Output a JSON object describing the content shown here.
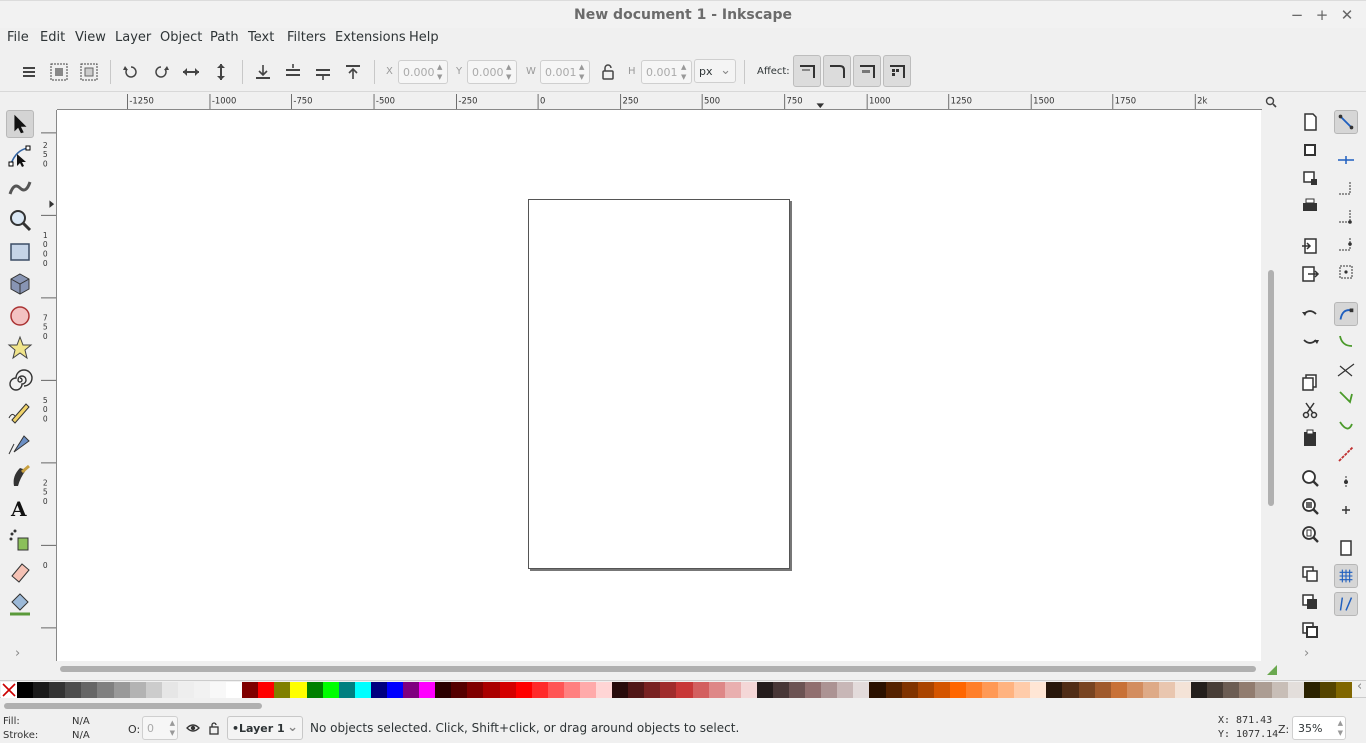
{
  "window": {
    "title": "New document 1 - Inkscape",
    "minimize": "−",
    "maximize": "+",
    "close": "✕"
  },
  "menu": [
    "File",
    "Edit",
    "View",
    "Layer",
    "Object",
    "Path",
    "Text",
    "Filters",
    "Extensions",
    "Help"
  ],
  "toolbar": {
    "x_label": "X",
    "x_value": "0.000",
    "y_label": "Y",
    "y_value": "0.000",
    "w_label": "W",
    "w_value": "0.001",
    "h_label": "H",
    "h_value": "0.001",
    "unit": "px",
    "affect_label": "Affect:"
  },
  "ruler": {
    "h_ticks": [
      "-1250",
      "-1000",
      "-750",
      "-500",
      "-250",
      "0",
      "250",
      "500",
      "750",
      "1000",
      "1250",
      "1500",
      "1750",
      "2k"
    ],
    "v_ticks": [
      "2",
      "5",
      "0",
      "1",
      "0",
      "0",
      "0",
      "7",
      "5",
      "0",
      "5",
      "0",
      "0",
      "2",
      "5",
      "0",
      "0"
    ]
  },
  "tools": [
    "selector",
    "node",
    "tweak",
    "zoom",
    "rect",
    "3dbox",
    "ellipse",
    "star",
    "spiral",
    "pencil",
    "pen",
    "calligraphy",
    "text",
    "spray",
    "eraser",
    "bucket"
  ],
  "status": {
    "fill_label": "Fill:",
    "fill_value": "N/A",
    "stroke_label": "Stroke:",
    "stroke_value": "N/A",
    "opacity_label": "O:",
    "opacity_value": "0",
    "layer": "•Layer 1",
    "message": "No objects selected. Click, Shift+click, or drag around objects to select.",
    "cursor_x": "X:  871.43",
    "cursor_y": "Y: 1077.14",
    "zoom_label": "Z:",
    "zoom_value": "35%"
  },
  "palette": [
    "#000000",
    "#1a1a1a",
    "#333333",
    "#4d4d4d",
    "#666666",
    "#808080",
    "#999999",
    "#b3b3b3",
    "#cccccc",
    "#e6e6e6",
    "#eeeeee",
    "#f2f2f2",
    "#f8f8f8",
    "#ffffff",
    "#800000",
    "#ff0000",
    "#808000",
    "#ffff00",
    "#008000",
    "#00ff00",
    "#008080",
    "#00ffff",
    "#000080",
    "#0000ff",
    "#800080",
    "#ff00ff",
    "#2b0000",
    "#550000",
    "#800000",
    "#aa0000",
    "#d40000",
    "#ff0000",
    "#ff2a2a",
    "#ff5555",
    "#ff8080",
    "#ffaaaa",
    "#ffd5d5",
    "#280b0b",
    "#501616",
    "#782121",
    "#a02c2c",
    "#c83737",
    "#d35f5f",
    "#de8787",
    "#e9afaf",
    "#f4d7d7",
    "#241c1c",
    "#483737",
    "#6c5353",
    "#916f6f",
    "#ac9393",
    "#c8b7b7",
    "#e3dbdb",
    "#2b1100",
    "#552200",
    "#803300",
    "#aa4400",
    "#d45500",
    "#ff6600",
    "#ff7f2a",
    "#ff9955",
    "#ffb380",
    "#ffccaa",
    "#ffe6d5",
    "#28170b",
    "#502d16",
    "#784421",
    "#a05a2c",
    "#c87137",
    "#d38d5f",
    "#deaa87",
    "#e9c6af",
    "#f4e3d7",
    "#241f1c",
    "#483e37",
    "#6c5d53",
    "#917c6f",
    "#ac9d93",
    "#c8beb7",
    "#e3dedb",
    "#2b2200",
    "#554400",
    "#806600"
  ]
}
